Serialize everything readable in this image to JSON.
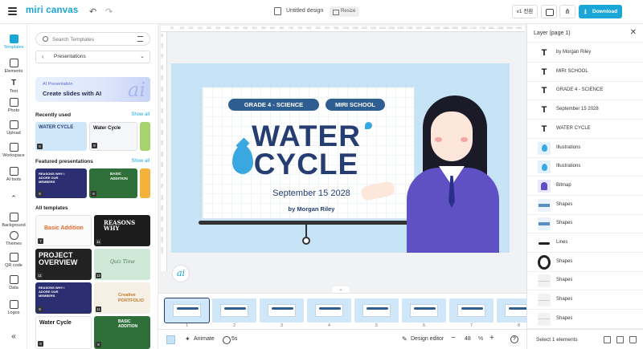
{
  "app": {
    "logo": "miri canvas",
    "doc_title": "Untitled design",
    "resize_label": "Resize",
    "version_label": "v1 전환",
    "download_label": "Download"
  },
  "rail": {
    "items": [
      {
        "label": "Templates",
        "icon": "templates-icon"
      },
      {
        "label": "Elements",
        "icon": "elements-icon"
      },
      {
        "label": "Text",
        "icon": "text-icon"
      },
      {
        "label": "Photo",
        "icon": "photo-icon"
      },
      {
        "label": "Upload",
        "icon": "upload-icon"
      },
      {
        "label": "Workspace",
        "icon": "workspace-icon"
      },
      {
        "label": "AI tools",
        "icon": "ai-tools-icon"
      },
      {
        "label": "Background",
        "icon": "background-icon"
      },
      {
        "label": "Themes",
        "icon": "themes-icon"
      },
      {
        "label": "QR code",
        "icon": "qr-code-icon"
      },
      {
        "label": "Data",
        "icon": "data-icon"
      },
      {
        "label": "Logos",
        "icon": "logos-icon"
      }
    ]
  },
  "panel": {
    "search_placeholder": "Search Templates",
    "category": "Presentations",
    "ai_small": "AI Presentation",
    "ai_big": "Create slides with AI",
    "ai_glyph": "ai",
    "recent_title": "Recently used",
    "featured_title": "Featured presentations",
    "all_title": "All templates",
    "show_all": "Show all",
    "recent": [
      {
        "title": "WATER CYCLE",
        "num": "8"
      },
      {
        "title": "Water Cycle",
        "num": "8"
      }
    ],
    "featured": [
      {
        "title": "REASONS WHY I ADORE OUR MEMBERS",
        "num": "8"
      },
      {
        "title": "BASIC ADDITION",
        "num": "8"
      }
    ],
    "all": [
      {
        "title": "Basic Addition",
        "num": "7"
      },
      {
        "title": "REASONS WHY",
        "num": "11"
      },
      {
        "title": "PROJECT OVERVIEW",
        "num": "11"
      },
      {
        "title": "Quiz Time",
        "num": "12"
      },
      {
        "title": "REASONS WHY I ADORE OUR MEMBERS",
        "num": "8"
      },
      {
        "title": "Creative PORTFOLIO",
        "num": "11"
      },
      {
        "title": "Water Cycle",
        "num": "8"
      },
      {
        "title": "BASIC ADDITION",
        "num": "8"
      }
    ]
  },
  "slide": {
    "pill_grade": "GRADE 4 - SCIENCE",
    "pill_school": "MIRI SCHOOL",
    "title_line1": "WATER",
    "title_line2": "CYCLE",
    "date": "September 15 2028",
    "author": "by Morgan Riley",
    "bg_color": "#c7e4f7",
    "title_color": "#263d72"
  },
  "ruler": {
    "top": [
      "50",
      "100",
      "150",
      "200",
      "250",
      "300",
      "350",
      "400",
      "450",
      "500",
      "550",
      "600",
      "650",
      "700",
      "750",
      "800",
      "850",
      "900",
      "950",
      "1000",
      "1050",
      "1100",
      "1150",
      "1200",
      "1250",
      "1300",
      "1350",
      "1400",
      "1450",
      "1500",
      "1550",
      "1600",
      "1650",
      "1700",
      "1750",
      "1800",
      "1850",
      "1900",
      "1950"
    ],
    "left": [
      "50",
      "100",
      "150",
      "200",
      "250",
      "300",
      "350",
      "400",
      "450",
      "500",
      "550",
      "600",
      "650",
      "700",
      "750",
      "800",
      "850",
      "900",
      "950",
      "1000",
      "1050"
    ]
  },
  "pages": {
    "numbers": [
      "1",
      "2",
      "3",
      "4",
      "5",
      "6",
      "7",
      "8"
    ]
  },
  "bottom": {
    "animate": "Animate",
    "timer": "5s",
    "design_editor": "Design editor",
    "zoom_minus": "−",
    "zoom": "48",
    "zoom_pct": "%",
    "zoom_plus": "+",
    "help": "?"
  },
  "layers": {
    "title": "Layer (page 1)",
    "rows": [
      {
        "type": "t",
        "name": "by Morgan Riley",
        "icon": "text-layer-icon"
      },
      {
        "type": "t",
        "name": "MIRI SCHOOL",
        "icon": "text-layer-icon"
      },
      {
        "type": "t",
        "name": "GRADE 4 - SCIENCE",
        "icon": "text-layer-icon"
      },
      {
        "type": "t",
        "name": "September 15 2028",
        "icon": "text-layer-icon"
      },
      {
        "type": "t",
        "name": "WATER CYCLE",
        "icon": "text-layer-icon"
      },
      {
        "type": "img",
        "name": "Illustrations",
        "icon": "illustration-layer-icon"
      },
      {
        "type": "img",
        "name": "Illustrations",
        "icon": "illustration-layer-icon"
      },
      {
        "type": "bmp",
        "name": "Bitmap",
        "icon": "bitmap-layer-icon"
      },
      {
        "type": "shape",
        "name": "Shapes",
        "icon": "shape-layer-icon"
      },
      {
        "type": "shape",
        "name": "Shapes",
        "icon": "shape-layer-icon"
      },
      {
        "type": "line",
        "name": "Lines",
        "icon": "line-layer-icon"
      },
      {
        "type": "ring",
        "name": "Shapes",
        "icon": "shape-layer-icon"
      },
      {
        "type": "grey",
        "name": "Shapes",
        "icon": "shape-layer-icon"
      },
      {
        "type": "grey",
        "name": "Shapes",
        "icon": "shape-layer-icon"
      },
      {
        "type": "grey",
        "name": "Shapes",
        "icon": "shape-layer-icon"
      }
    ],
    "select_count": "Select 1 elements"
  }
}
